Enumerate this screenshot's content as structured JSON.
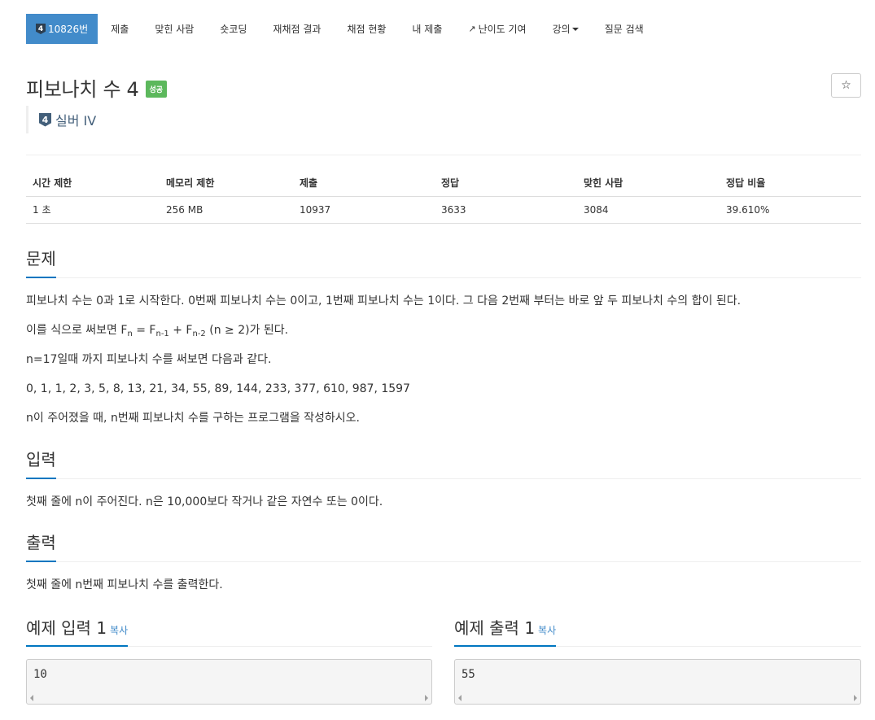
{
  "nav": {
    "problem_badge": "4",
    "problem_number": "10826번",
    "items": [
      "제출",
      "맞힌 사람",
      "숏코딩",
      "재채점 결과",
      "채점 현황",
      "내 제출",
      "난이도 기여",
      "강의",
      "질문 검색"
    ]
  },
  "title": "피보나치 수 4",
  "status_badge": "성공",
  "star_icon": "☆",
  "tier": {
    "badge": "4",
    "label": "실버 IV"
  },
  "stats": {
    "headers": [
      "시간 제한",
      "메모리 제한",
      "제출",
      "정답",
      "맞힌 사람",
      "정답 비율"
    ],
    "values": [
      "1 초",
      "256 MB",
      "10937",
      "3633",
      "3084",
      "39.610%"
    ]
  },
  "sections": {
    "problem": "문제",
    "input": "입력",
    "output": "출력"
  },
  "problem": {
    "p1": "피보나치 수는 0과 1로 시작한다. 0번째 피보나치 수는 0이고, 1번째 피보나치 수는 1이다. 그 다음 2번째 부터는 바로 앞 두 피보나치 수의 합이 된다.",
    "p2_before": "이를 식으로 써보면 F",
    "p2_sub1": "n",
    "p2_mid1": " = F",
    "p2_sub2": "n-1",
    "p2_mid2": " + F",
    "p2_sub3": "n-2",
    "p2_after": " (n ≥ 2)가 된다.",
    "p3": "n=17일때 까지 피보나치 수를 써보면 다음과 같다.",
    "p4": "0, 1, 1, 2, 3, 5, 8, 13, 21, 34, 55, 89, 144, 233, 377, 610, 987, 1597",
    "p5": "n이 주어졌을 때, n번째 피보나치 수를 구하는 프로그램을 작성하시오."
  },
  "input_text": "첫째 줄에 n이 주어진다. n은 10,000보다 작거나 같은 자연수 또는 0이다.",
  "output_text": "첫째 줄에 n번째 피보나치 수를 출력한다.",
  "samples": {
    "input_title": "예제 입력 1",
    "output_title": "예제 출력 1",
    "copy_label": "복사",
    "input_value": "10",
    "output_value": "55"
  },
  "colors": {
    "nav_active": "#428bca",
    "success": "#5cb85c",
    "tier": "#435f7a",
    "heading_underline": "#0076c0"
  }
}
